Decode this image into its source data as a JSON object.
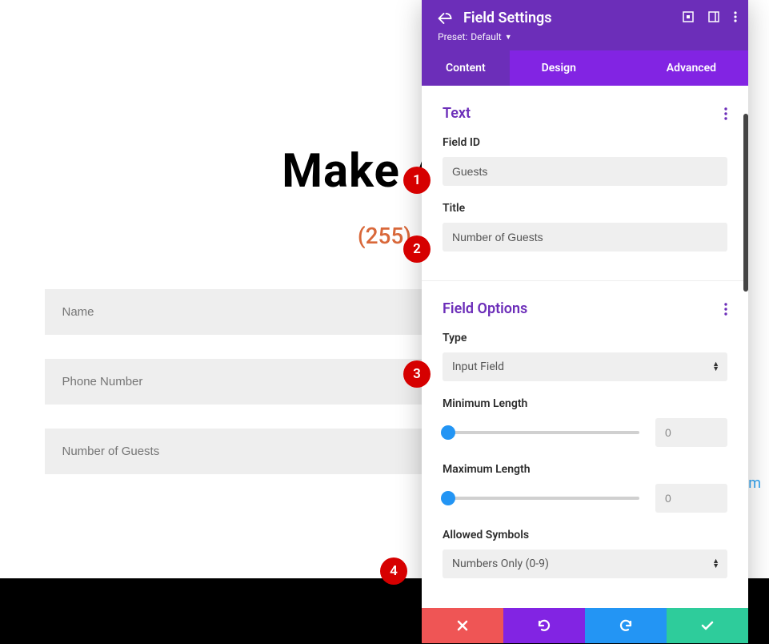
{
  "page": {
    "heading": "Make A R",
    "phone_display": "(255)",
    "fields": [
      "Name",
      "Phone Number",
      "Number of Guests"
    ],
    "bottom_link_fragment": "om"
  },
  "panel": {
    "header": {
      "title": "Field Settings",
      "preset_prefix": "Preset:",
      "preset_value": "Default"
    },
    "tabs": {
      "content": "Content",
      "design": "Design",
      "advanced": "Advanced"
    },
    "sections": {
      "text": {
        "title": "Text",
        "field_id_label": "Field ID",
        "field_id_value": "Guests",
        "title_label": "Title",
        "title_value": "Number of Guests"
      },
      "field_options": {
        "title": "Field Options",
        "type_label": "Type",
        "type_value": "Input Field",
        "min_label": "Minimum Length",
        "min_value": "0",
        "max_label": "Maximum Length",
        "max_value": "0",
        "allowed_label": "Allowed Symbols",
        "allowed_value": "Numbers Only (0-9)"
      }
    }
  },
  "annotations": {
    "b1": "1",
    "b2": "2",
    "b3": "3",
    "b4": "4"
  }
}
